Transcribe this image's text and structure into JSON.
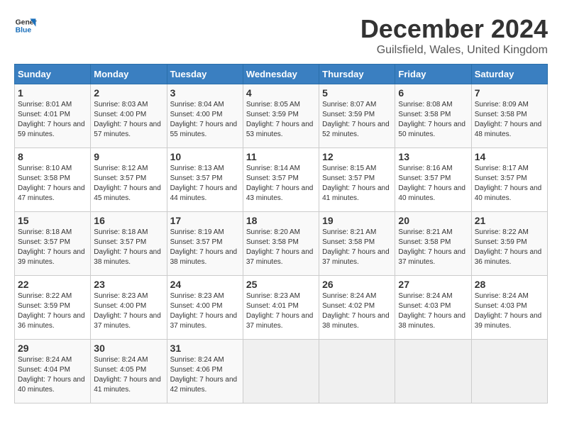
{
  "logo": {
    "line1": "General",
    "line2": "Blue"
  },
  "title": "December 2024",
  "subtitle": "Guilsfield, Wales, United Kingdom",
  "weekdays": [
    "Sunday",
    "Monday",
    "Tuesday",
    "Wednesday",
    "Thursday",
    "Friday",
    "Saturday"
  ],
  "weeks": [
    [
      {
        "day": "1",
        "sunrise": "8:01 AM",
        "sunset": "4:01 PM",
        "daylight": "7 hours and 59 minutes."
      },
      {
        "day": "2",
        "sunrise": "8:03 AM",
        "sunset": "4:00 PM",
        "daylight": "7 hours and 57 minutes."
      },
      {
        "day": "3",
        "sunrise": "8:04 AM",
        "sunset": "4:00 PM",
        "daylight": "7 hours and 55 minutes."
      },
      {
        "day": "4",
        "sunrise": "8:05 AM",
        "sunset": "3:59 PM",
        "daylight": "7 hours and 53 minutes."
      },
      {
        "day": "5",
        "sunrise": "8:07 AM",
        "sunset": "3:59 PM",
        "daylight": "7 hours and 52 minutes."
      },
      {
        "day": "6",
        "sunrise": "8:08 AM",
        "sunset": "3:58 PM",
        "daylight": "7 hours and 50 minutes."
      },
      {
        "day": "7",
        "sunrise": "8:09 AM",
        "sunset": "3:58 PM",
        "daylight": "7 hours and 48 minutes."
      }
    ],
    [
      {
        "day": "8",
        "sunrise": "8:10 AM",
        "sunset": "3:58 PM",
        "daylight": "7 hours and 47 minutes."
      },
      {
        "day": "9",
        "sunrise": "8:12 AM",
        "sunset": "3:57 PM",
        "daylight": "7 hours and 45 minutes."
      },
      {
        "day": "10",
        "sunrise": "8:13 AM",
        "sunset": "3:57 PM",
        "daylight": "7 hours and 44 minutes."
      },
      {
        "day": "11",
        "sunrise": "8:14 AM",
        "sunset": "3:57 PM",
        "daylight": "7 hours and 43 minutes."
      },
      {
        "day": "12",
        "sunrise": "8:15 AM",
        "sunset": "3:57 PM",
        "daylight": "7 hours and 41 minutes."
      },
      {
        "day": "13",
        "sunrise": "8:16 AM",
        "sunset": "3:57 PM",
        "daylight": "7 hours and 40 minutes."
      },
      {
        "day": "14",
        "sunrise": "8:17 AM",
        "sunset": "3:57 PM",
        "daylight": "7 hours and 40 minutes."
      }
    ],
    [
      {
        "day": "15",
        "sunrise": "8:18 AM",
        "sunset": "3:57 PM",
        "daylight": "7 hours and 39 minutes."
      },
      {
        "day": "16",
        "sunrise": "8:18 AM",
        "sunset": "3:57 PM",
        "daylight": "7 hours and 38 minutes."
      },
      {
        "day": "17",
        "sunrise": "8:19 AM",
        "sunset": "3:57 PM",
        "daylight": "7 hours and 38 minutes."
      },
      {
        "day": "18",
        "sunrise": "8:20 AM",
        "sunset": "3:58 PM",
        "daylight": "7 hours and 37 minutes."
      },
      {
        "day": "19",
        "sunrise": "8:21 AM",
        "sunset": "3:58 PM",
        "daylight": "7 hours and 37 minutes."
      },
      {
        "day": "20",
        "sunrise": "8:21 AM",
        "sunset": "3:58 PM",
        "daylight": "7 hours and 37 minutes."
      },
      {
        "day": "21",
        "sunrise": "8:22 AM",
        "sunset": "3:59 PM",
        "daylight": "7 hours and 36 minutes."
      }
    ],
    [
      {
        "day": "22",
        "sunrise": "8:22 AM",
        "sunset": "3:59 PM",
        "daylight": "7 hours and 36 minutes."
      },
      {
        "day": "23",
        "sunrise": "8:23 AM",
        "sunset": "4:00 PM",
        "daylight": "7 hours and 37 minutes."
      },
      {
        "day": "24",
        "sunrise": "8:23 AM",
        "sunset": "4:00 PM",
        "daylight": "7 hours and 37 minutes."
      },
      {
        "day": "25",
        "sunrise": "8:23 AM",
        "sunset": "4:01 PM",
        "daylight": "7 hours and 37 minutes."
      },
      {
        "day": "26",
        "sunrise": "8:24 AM",
        "sunset": "4:02 PM",
        "daylight": "7 hours and 38 minutes."
      },
      {
        "day": "27",
        "sunrise": "8:24 AM",
        "sunset": "4:03 PM",
        "daylight": "7 hours and 38 minutes."
      },
      {
        "day": "28",
        "sunrise": "8:24 AM",
        "sunset": "4:03 PM",
        "daylight": "7 hours and 39 minutes."
      }
    ],
    [
      {
        "day": "29",
        "sunrise": "8:24 AM",
        "sunset": "4:04 PM",
        "daylight": "7 hours and 40 minutes."
      },
      {
        "day": "30",
        "sunrise": "8:24 AM",
        "sunset": "4:05 PM",
        "daylight": "7 hours and 41 minutes."
      },
      {
        "day": "31",
        "sunrise": "8:24 AM",
        "sunset": "4:06 PM",
        "daylight": "7 hours and 42 minutes."
      },
      null,
      null,
      null,
      null
    ]
  ],
  "labels": {
    "sunrise": "Sunrise:",
    "sunset": "Sunset:",
    "daylight": "Daylight:"
  }
}
